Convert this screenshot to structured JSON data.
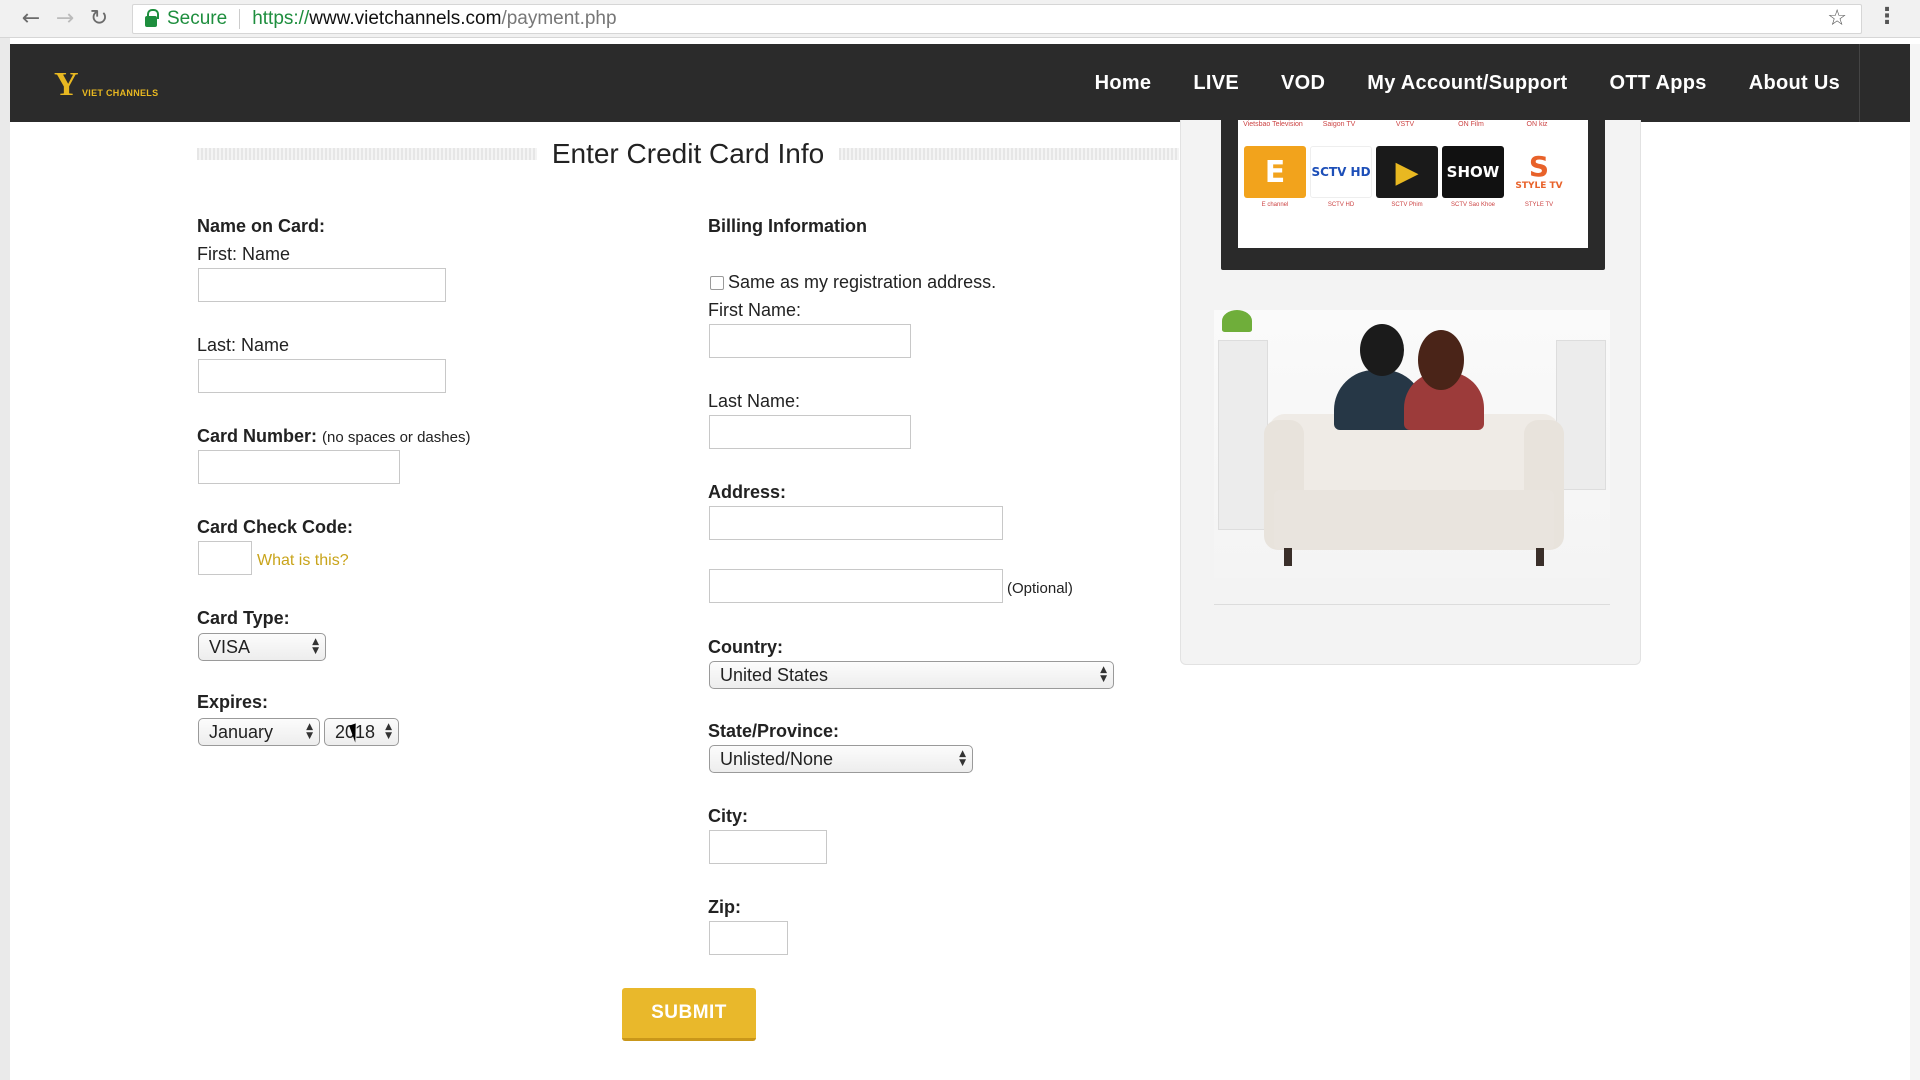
{
  "browser": {
    "secure_label": "Secure",
    "url_scheme": "https://",
    "url_host": "www.vietchannels.com",
    "url_path": "/payment.php"
  },
  "site": {
    "logo_mark": "Y",
    "logo_text": "VIET CHANNELS",
    "nav": [
      "Home",
      "LIVE",
      "VOD",
      "My Account/Support",
      "OTT Apps",
      "About Us"
    ]
  },
  "form": {
    "title": "Enter Credit Card Info",
    "name_on_card_label": "Name on Card:",
    "first_name_label": "First: Name",
    "last_name_label": "Last: Name",
    "card_number_label": "Card Number:",
    "card_number_hint": "(no spaces or dashes)",
    "card_check_label": "Card Check Code:",
    "what_is_this": "What is this?",
    "card_type_label": "Card Type:",
    "card_type_value": "VISA",
    "expires_label": "Expires:",
    "expires_month": "January",
    "expires_year": "2018",
    "billing_title": "Billing Information",
    "same_as_registration": "Same as my registration address.",
    "billing_first_label": "First Name:",
    "billing_last_label": "Last Name:",
    "address_label": "Address:",
    "optional_label": "(Optional)",
    "country_label": "Country:",
    "country_value": "United States",
    "state_label": "State/Province:",
    "state_value": "Unlisted/None",
    "city_label": "City:",
    "zip_label": "Zip:",
    "submit_label": "SUBMIT"
  },
  "sidebar": {
    "channels": [
      {
        "name": "E",
        "top_label": "Vietsbao Television",
        "sub": "E channel",
        "color": "#f2a31c"
      },
      {
        "name": "SCTV HD",
        "top_label": "Saigon TV",
        "sub": "SCTV HD",
        "color": "#ffffff"
      },
      {
        "name": "▶",
        "top_label": "VSTV",
        "sub": "SCTV Phim",
        "color": "#e8b821"
      },
      {
        "name": "SHOW",
        "top_label": "ON Film",
        "sub": "SCTV Sao Khoe",
        "color": "#111111"
      },
      {
        "name": "S",
        "top_label": "ON kiz",
        "sub": "STYLE TV",
        "color": "#ffffff"
      }
    ],
    "style_tv_label": "STYLE TV"
  },
  "colors": {
    "header_bg": "#2b2b2b",
    "accent": "#e9b82b",
    "link": "#c9a41b"
  }
}
